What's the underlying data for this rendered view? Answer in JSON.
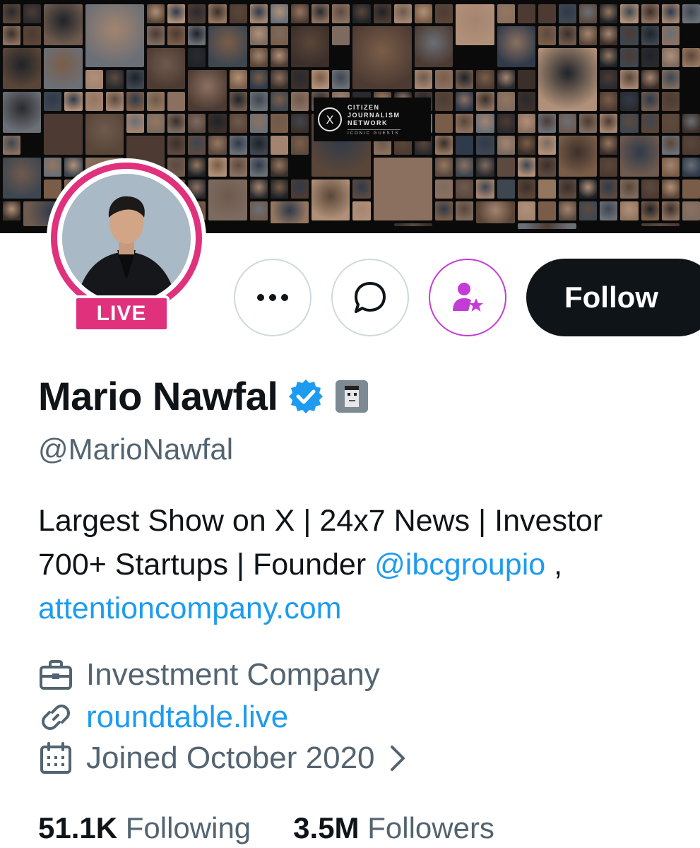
{
  "banner": {
    "brand_line1": "CITIZEN",
    "brand_line2": "JOURNALISM",
    "brand_line3": "NETWORK",
    "brand_sub": "ICONIC GUESTS",
    "brand_logo_glyph": "X"
  },
  "profile": {
    "live_label": "LIVE",
    "display_name": "Mario Nawfal",
    "handle": "@MarioNawfal",
    "bio_line1": "Largest Show on X | 24x7 News | Investor",
    "bio_line2_text": "700+ Startups | Founder ",
    "bio_line2_link": "@ibcgroupio",
    "bio_line2_tail": " ,",
    "bio_line3_link": "attentioncompany.com",
    "category": "Investment Company",
    "website": "roundtable.live",
    "joined": "Joined October 2020"
  },
  "actions": {
    "follow_label": "Follow"
  },
  "stats": {
    "following_count": "51.1K",
    "following_label": "Following",
    "followers_count": "3.5M",
    "followers_label": "Followers"
  },
  "colors": {
    "live_pink": "#e0317d",
    "link_blue": "#1d9bf0",
    "verified_blue": "#1d9bf0",
    "subscribe_purple": "#c43cd6",
    "text_dark": "#0f1419",
    "text_muted": "#536471"
  },
  "icons": {
    "more": "more-icon",
    "message": "message-icon",
    "subscribe": "subscribe-star-person-icon",
    "verified": "verified-badge-icon",
    "category": "briefcase-icon",
    "website": "link-icon",
    "joined": "calendar-icon",
    "chevron": "chevron-right-icon"
  }
}
